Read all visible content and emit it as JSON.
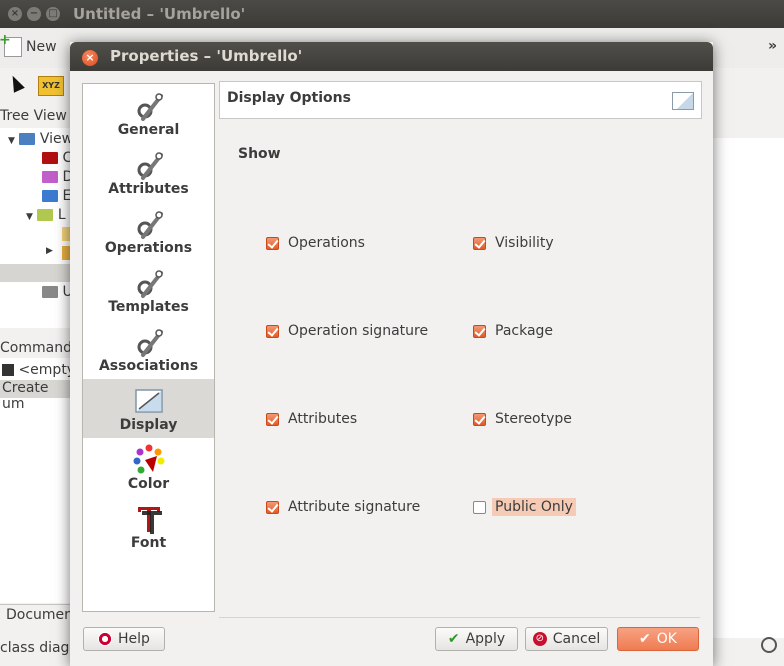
{
  "main_window": {
    "title": "Untitled – 'Umbrello'",
    "toolbar_new_label": "New",
    "toolbar_more": "»",
    "tool_xyz": "XYZ",
    "tree_view_label": "Tree View",
    "tree_rows": [
      "View",
      "C",
      "D",
      "E",
      "L",
      "U"
    ],
    "command_label": "Command",
    "command_row1": "<empty",
    "command_row2": "Create um",
    "document_tab": "Documen",
    "status_text": "class diagr"
  },
  "dialog": {
    "title": "Properties – 'Umbrello'",
    "sidebar": [
      {
        "label": "General",
        "icon": "wrench-gear-icon"
      },
      {
        "label": "Attributes",
        "icon": "wrench-gear-icon"
      },
      {
        "label": "Operations",
        "icon": "wrench-gear-icon"
      },
      {
        "label": "Templates",
        "icon": "wrench-gear-icon"
      },
      {
        "label": "Associations",
        "icon": "wrench-gear-icon"
      },
      {
        "label": "Display",
        "icon": "display-icon",
        "selected": true
      },
      {
        "label": "Color",
        "icon": "color-palette-icon"
      },
      {
        "label": "Font",
        "icon": "font-icon"
      }
    ],
    "page_header": "Display Options",
    "section_label": "Show",
    "options": [
      {
        "label": "Operations",
        "checked": true
      },
      {
        "label": "Visibility",
        "checked": true
      },
      {
        "label": "Operation signature",
        "checked": true
      },
      {
        "label": "Package",
        "checked": true
      },
      {
        "label": "Attributes",
        "checked": true
      },
      {
        "label": "Stereotype",
        "checked": true
      },
      {
        "label": "Attribute signature",
        "checked": true
      },
      {
        "label": "Public Only",
        "checked": false,
        "highlighted": true
      }
    ],
    "buttons": {
      "help": "Help",
      "apply": "Apply",
      "cancel": "Cancel",
      "ok": "OK"
    }
  },
  "colors": {
    "accent": "#e8683a",
    "titlebar": "#3c3b37",
    "selection": "#dad9d5"
  }
}
